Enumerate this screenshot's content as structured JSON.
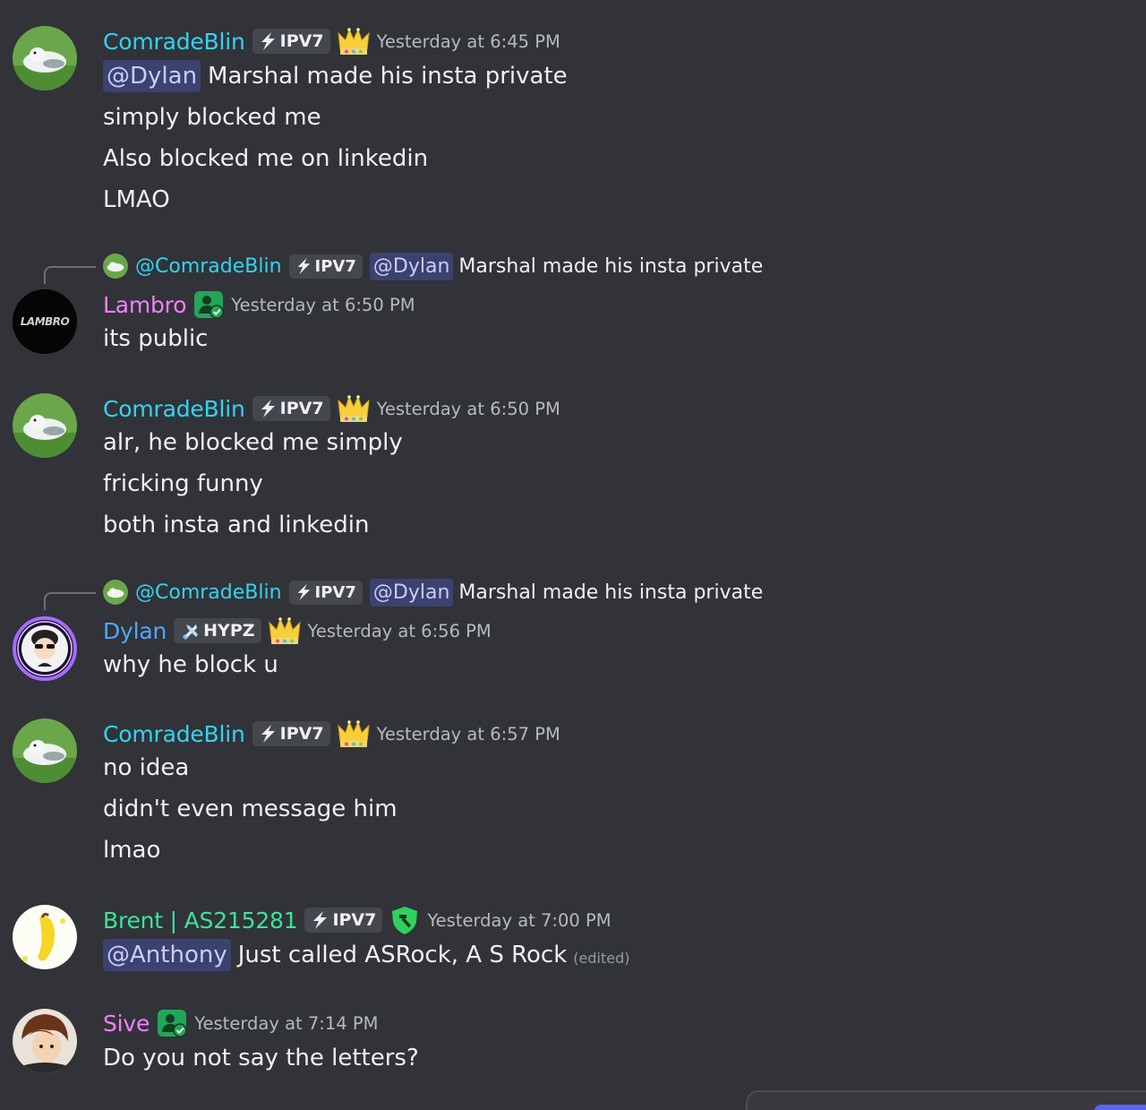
{
  "colors": {
    "background": "#313338",
    "comrade": "#35d3f0",
    "lambro": "#f47fff",
    "dylan": "#4fa8ff",
    "brent": "#3ee39a",
    "sive": "#f47fff",
    "mention_bg": "#3c4270",
    "timestamp": "#b5bac1"
  },
  "messages": [
    {
      "author": "ComradeBlin",
      "tag": "IPV7",
      "badge": "crown-icon",
      "time": "Yesterday at 6:45 PM",
      "lines": [
        {
          "mention": "@Dylan",
          "text": "Marshal made his insta private"
        },
        {
          "text": "simply blocked me"
        },
        {
          "text": "Also blocked me on linkedin"
        },
        {
          "text": "LMAO"
        }
      ]
    },
    {
      "reply": {
        "author": "@ComradeBlin",
        "tag": "IPV7",
        "mention": "@Dylan",
        "text": "Marshal made his insta private"
      },
      "author": "Lambro",
      "avatar_text": "LAMBRO",
      "badge": "contact-check-icon",
      "time": "Yesterday at 6:50 PM",
      "lines": [
        {
          "text": "its public"
        }
      ]
    },
    {
      "author": "ComradeBlin",
      "tag": "IPV7",
      "badge": "crown-icon",
      "time": "Yesterday at 6:50 PM",
      "lines": [
        {
          "text": "alr, he blocked me simply"
        },
        {
          "text": "fricking funny"
        },
        {
          "text": "both insta and linkedin"
        }
      ]
    },
    {
      "reply": {
        "author": "@ComradeBlin",
        "tag": "IPV7",
        "mention": "@Dylan",
        "text": "Marshal made his insta private"
      },
      "author": "Dylan",
      "tag": "HYPZ",
      "badge": "crown-icon",
      "time": "Yesterday at 6:56 PM",
      "lines": [
        {
          "text": "why he block u"
        }
      ]
    },
    {
      "author": "ComradeBlin",
      "tag": "IPV7",
      "badge": "crown-icon",
      "time": "Yesterday at 6:57 PM",
      "lines": [
        {
          "text": "no idea"
        },
        {
          "text": "didn't even message him"
        },
        {
          "text": "lmao"
        }
      ]
    },
    {
      "author": "Brent | AS215281",
      "tag": "IPV7",
      "badge": "shield-hammer-icon",
      "time": "Yesterday at 7:00 PM",
      "lines": [
        {
          "mention": "@Anthony",
          "text": "Just called ASRock, A S Rock",
          "edited": "(edited)"
        }
      ]
    },
    {
      "author": "Sive",
      "badge": "contact-check-icon",
      "time": "Yesterday at 7:14 PM",
      "lines": [
        {
          "text": "Do you not say the letters?"
        }
      ]
    }
  ]
}
